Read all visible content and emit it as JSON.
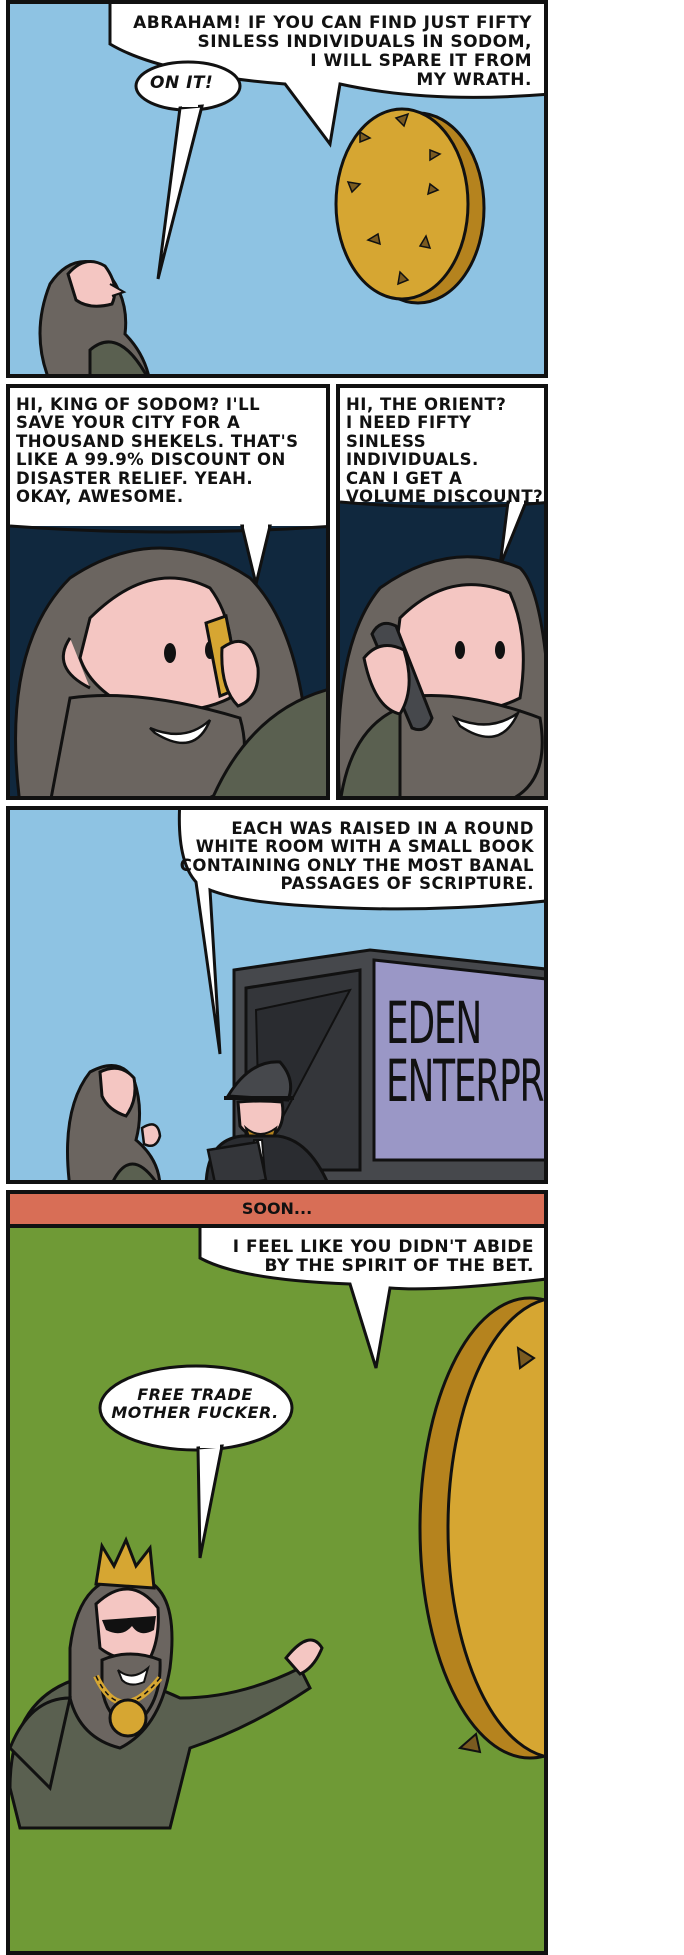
{
  "panels": {
    "p1": {
      "god_speech": "ABRAHAM! IF YOU CAN FIND JUST FIFTY SINLESS INDIVIDUALS IN SODOM, I WILL SPARE IT FROM MY WRATH.",
      "god_speech_lines": [
        "ABRAHAM! IF YOU CAN FIND JUST FIFTY",
        "SINLESS INDIVIDUALS IN SODOM,",
        "I WILL SPARE IT FROM",
        "MY WRATH."
      ],
      "abraham_reply": "ON IT!"
    },
    "p2": {
      "speech_lines": [
        "HI, KING OF SODOM? I'LL",
        "SAVE YOUR CITY FOR A",
        "THOUSAND SHEKELS. THAT'S",
        "LIKE A 99.9% DISCOUNT ON",
        "DISASTER RELIEF. YEAH.",
        "OKAY, AWESOME."
      ]
    },
    "p3": {
      "speech_lines": [
        "HI, THE ORIENT?",
        "I NEED FIFTY",
        "SINLESS INDIVIDUALS.",
        "CAN I GET A",
        "VOLUME DISCOUNT?"
      ]
    },
    "p4": {
      "speech_lines": [
        "EACH WAS RAISED IN A ROUND",
        "WHITE ROOM WITH A SMALL BOOK",
        "CONTAINING ONLY THE MOST BANAL",
        "PASSAGES OF SCRIPTURE."
      ],
      "sign_lines": [
        "EDEN",
        "ENTERPRI"
      ]
    },
    "p5": {
      "caption": "SOON...",
      "god_speech_lines": [
        "I FEEL LIKE YOU DIDN'T ABIDE",
        "BY THE SPIRIT OF THE BET."
      ],
      "king_speech_lines": [
        "FREE TRADE",
        "MOTHER FUCKER."
      ]
    }
  },
  "colors": {
    "sky": "#8ec3e3",
    "night": "#10283e",
    "grass": "#6f9a36",
    "caption": "#d86e56",
    "gold": "#d6a632",
    "beard": "#6b6560",
    "skin": "#f4c6c2",
    "robe": "#5a6050",
    "truck_sign": "#9a97c6",
    "truck": "#46484c"
  },
  "icons": [
    "god-coin-icon",
    "phone-icon",
    "crown-icon",
    "sunglasses-icon",
    "gold-chain-icon"
  ]
}
